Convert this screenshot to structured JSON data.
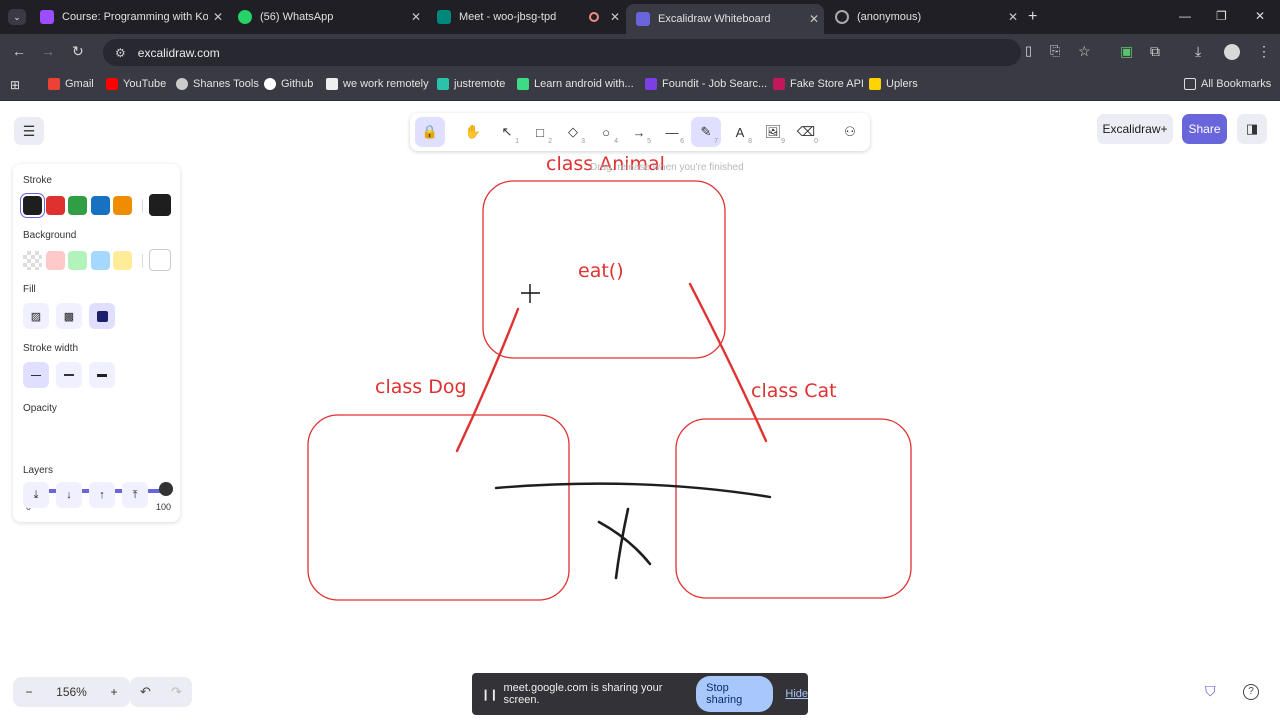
{
  "browser": {
    "tabs": [
      {
        "title": "Course: Programming with Kotl",
        "color": "#9b4dff"
      },
      {
        "title": "(56) WhatsApp",
        "color": "#25d366"
      },
      {
        "title": "Meet - woo-jbsg-tpd",
        "color": "#00897b"
      },
      {
        "title": "Excalidraw Whiteboard",
        "color": "#6965db"
      },
      {
        "title": "(anonymous)",
        "color": "#888888"
      }
    ],
    "url": "excalidraw.com",
    "bookmarks": [
      {
        "label": "Gmail",
        "color": "#ea4335"
      },
      {
        "label": "YouTube",
        "color": "#ff0000"
      },
      {
        "label": "Shanes Tools",
        "color": "#cccccc"
      },
      {
        "label": "Github",
        "color": "#ffffff"
      },
      {
        "label": "we work remotely",
        "color": "#eeeeee"
      },
      {
        "label": "justremote",
        "color": "#28c3a8"
      },
      {
        "label": "Learn android with...",
        "color": "#3ddc84"
      },
      {
        "label": "Foundit - Job Searc...",
        "color": "#7b3fe4"
      },
      {
        "label": "Fake Store API",
        "color": "#c2185b"
      },
      {
        "label": "Uplers",
        "color": "#ffd400"
      }
    ],
    "all_bookmarks": "All Bookmarks"
  },
  "toolbar": {
    "tools": [
      {
        "icon": "lock-icon",
        "glyph": "🔒",
        "key": ""
      },
      {
        "icon": "hand-icon",
        "glyph": "✋",
        "key": ""
      },
      {
        "icon": "selection-icon",
        "glyph": "↖",
        "key": "1"
      },
      {
        "icon": "rectangle-icon",
        "glyph": "□",
        "key": "2"
      },
      {
        "icon": "diamond-icon",
        "glyph": "◇",
        "key": "3"
      },
      {
        "icon": "ellipse-icon",
        "glyph": "○",
        "key": "4"
      },
      {
        "icon": "arrow-icon",
        "glyph": "→",
        "key": "5"
      },
      {
        "icon": "line-icon",
        "glyph": "—",
        "key": "6"
      },
      {
        "icon": "pencil-icon",
        "glyph": "✎",
        "key": "7"
      },
      {
        "icon": "text-icon",
        "glyph": "A",
        "key": "8"
      },
      {
        "icon": "image-icon",
        "glyph": "🖼",
        "key": "9"
      },
      {
        "icon": "eraser-icon",
        "glyph": "⌫",
        "key": "0"
      },
      {
        "icon": "more-tools-icon",
        "glyph": "⚇",
        "key": ""
      }
    ],
    "excalidraw_plus": "Excalidraw+",
    "share": "Share"
  },
  "panel": {
    "stroke_label": "Stroke",
    "stroke_colors": [
      "#1e1e1e",
      "#e03131",
      "#2f9e44",
      "#1971c2",
      "#f08c00"
    ],
    "stroke_current": "#1e1e1e",
    "background_label": "Background",
    "background_colors": [
      "transparent",
      "#ffc9c9",
      "#b2f2bb",
      "#a5d8ff",
      "#ffec99"
    ],
    "background_current": "#ffffff",
    "fill_label": "Fill",
    "stroke_width_label": "Stroke width",
    "opacity_label": "Opacity",
    "opacity_min": "0",
    "opacity_max": "100",
    "opacity_value": 100,
    "layers_label": "Layers"
  },
  "canvas": {
    "hint": "Drag, release when you're finished",
    "labels": {
      "animal": "class Animal",
      "method": "eat()",
      "dog": "class Dog",
      "cat": "class Cat"
    }
  },
  "footer": {
    "zoom": "156%",
    "sharing_text": "meet.google.com is sharing your screen.",
    "stop_sharing": "Stop sharing",
    "hide": "Hide"
  }
}
